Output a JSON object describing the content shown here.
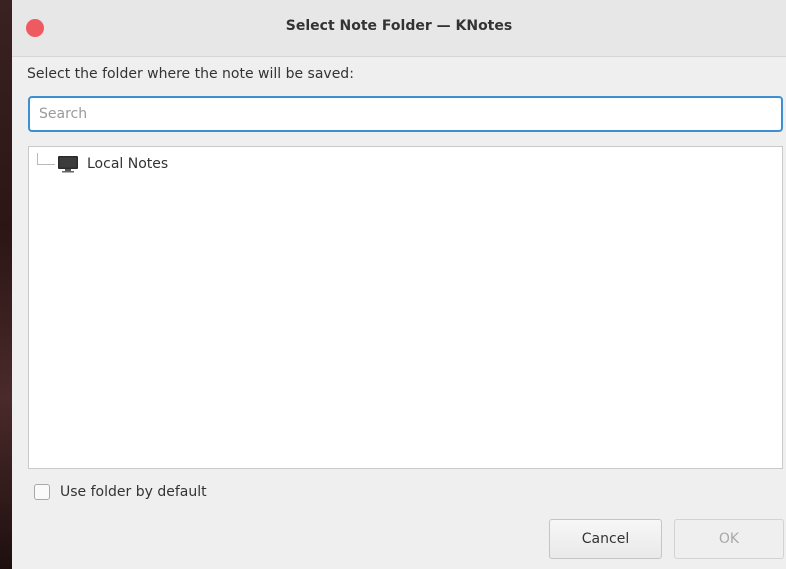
{
  "window": {
    "title": "Select Note Folder — KNotes"
  },
  "dialog": {
    "prompt": "Select the folder where the note will be saved:",
    "search_placeholder": "Search",
    "search_value": ""
  },
  "tree": {
    "items": [
      {
        "label": "Local Notes",
        "icon": "monitor-icon"
      }
    ]
  },
  "options": {
    "use_default_label": "Use folder by default",
    "use_default_checked": false
  },
  "buttons": {
    "cancel_label": "Cancel",
    "ok_label": "OK",
    "ok_enabled": false
  },
  "colors": {
    "close_button": "#ee5a5f",
    "focus_accent": "#3d8fd1"
  }
}
